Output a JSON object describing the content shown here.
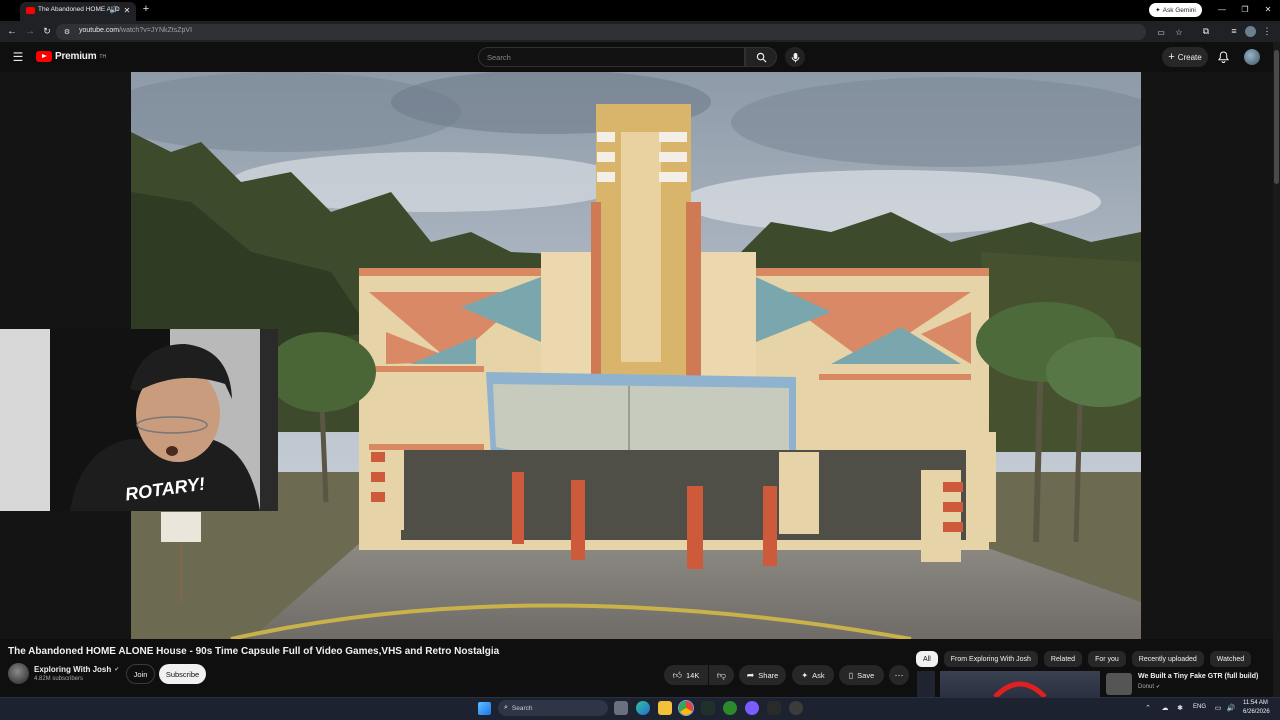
{
  "browser": {
    "tab_title": "The Abandoned HOME ALO",
    "new_tab_label": "+",
    "url_host": "youtube.com",
    "url_path": "/watch?v=JYNkZtsZpVI",
    "ask_gemini": "Ask Gemini"
  },
  "youtube": {
    "brand": "Premium",
    "brand_sup": "TH",
    "search_placeholder": "Search",
    "create_label": "Create"
  },
  "video": {
    "title": "The Abandoned HOME ALONE House - 90s Time Capsule Full of Video Games,VHS and Retro Nostalgia",
    "channel": "Exploring With Josh",
    "subscribers": "4.82M subscribers",
    "join_label": "Join",
    "subscribe_label": "Subscribe",
    "likes": "14K",
    "share_label": "Share",
    "ask_label": "Ask",
    "save_label": "Save",
    "webcam_shirt_text": "ROTARY!"
  },
  "chips": [
    "All",
    "From Exploring With Josh",
    "Related",
    "For you",
    "Recently uploaded",
    "Watched"
  ],
  "suggestion": {
    "title": "We Built a Tiny Fake GTR (full build)",
    "channel": "Donut"
  },
  "taskbar": {
    "search_placeholder": "Search",
    "lang": "ENG",
    "time": "11:54 AM",
    "date": "6/26/2026"
  },
  "colors": {
    "youtube_red": "#ff0000",
    "bg": "#0f0f0f",
    "chip_active": "#f1f1f1"
  }
}
